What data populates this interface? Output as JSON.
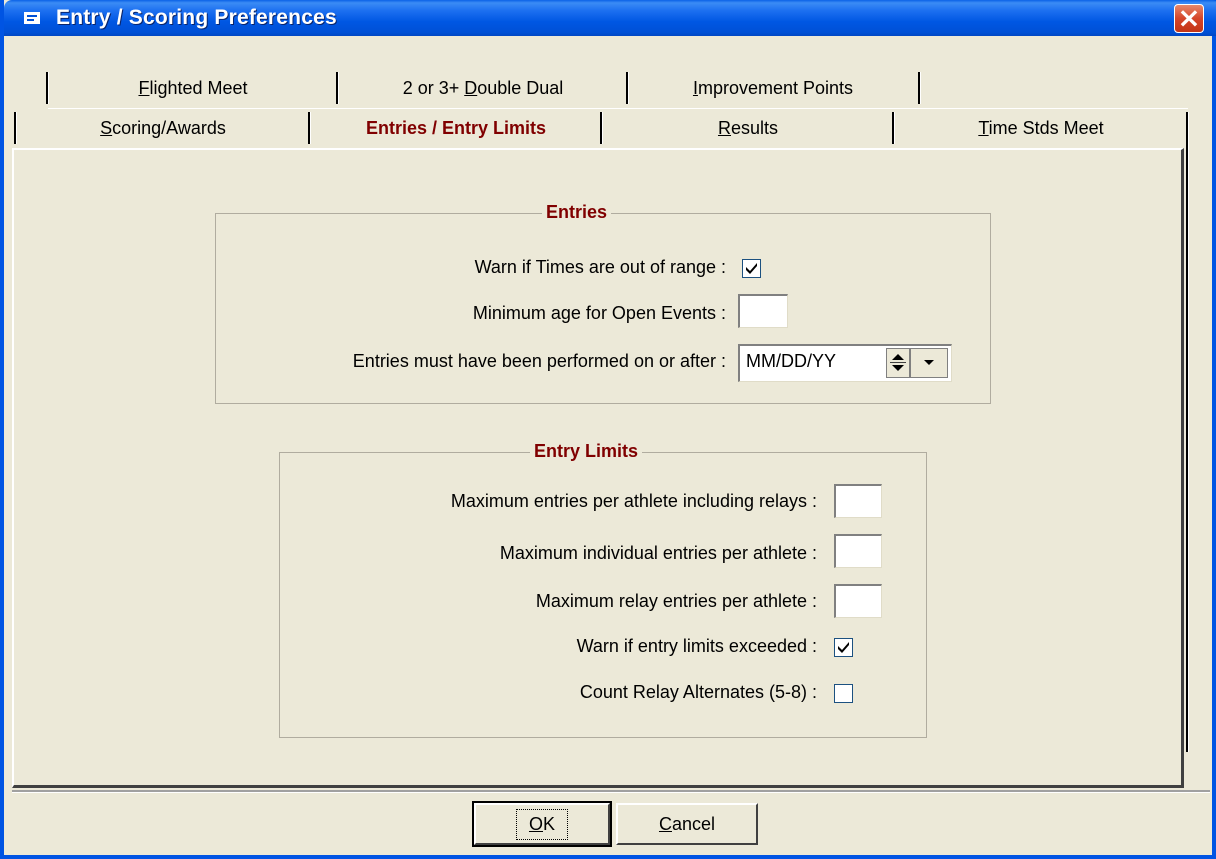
{
  "window": {
    "title": "Entry / Scoring Preferences"
  },
  "tabs": {
    "row1": [
      {
        "label_u": "F",
        "label_rest": "lighted Meet"
      },
      {
        "label_pre": "2 or 3+ ",
        "label_u": "D",
        "label_rest": "ouble Dual"
      },
      {
        "label_pre": "",
        "label_u": "I",
        "label_rest": "mprovement Points"
      }
    ],
    "row2": [
      {
        "label_pre": "",
        "label_u": "S",
        "label_rest": "coring/Awards"
      },
      {
        "label": "Entries / Entry Limits"
      },
      {
        "label_pre": "",
        "label_u": "R",
        "label_rest": "esults"
      },
      {
        "label_pre": "",
        "label_u": "T",
        "label_rest": "ime Stds Meet"
      }
    ]
  },
  "entries": {
    "title": "Entries",
    "warn_times_label": "Warn if Times are out of range :",
    "warn_times_checked": true,
    "min_age_label": "Minimum age for Open Events :",
    "min_age_value": "",
    "performed_after_label": "Entries must have been performed on or after :",
    "performed_after_value": "MM/DD/YY"
  },
  "entry_limits": {
    "title": "Entry Limits",
    "max_entries_label": "Maximum entries per athlete including relays :",
    "max_individual_label": "Maximum individual entries per athlete :",
    "max_relay_label": "Maximum relay entries per athlete :",
    "warn_exceeded_label": "Warn if entry limits exceeded :",
    "warn_exceeded_checked": true,
    "count_alternates_label": "Count Relay Alternates (5-8) :",
    "count_alternates_checked": false
  },
  "buttons": {
    "ok_u": "O",
    "ok_rest": "K",
    "cancel_u": "C",
    "cancel_rest": "ancel"
  }
}
